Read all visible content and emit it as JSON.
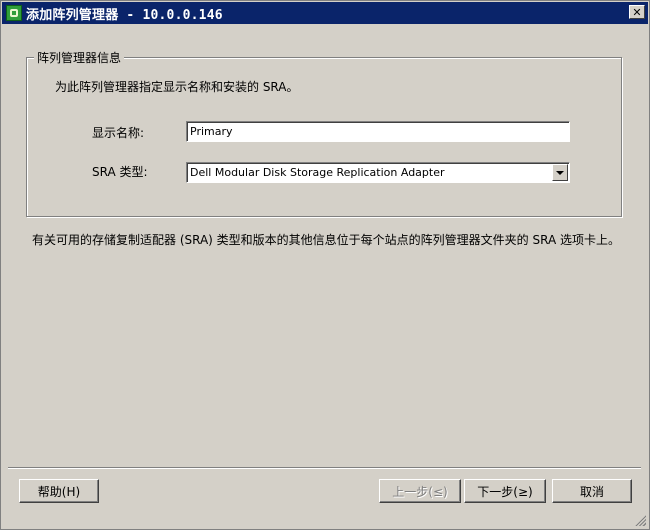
{
  "window": {
    "title": "添加阵列管理器 - 10.0.0.146",
    "app_icon": "srm-app-icon",
    "close_icon": "close-icon"
  },
  "group": {
    "legend": "阵列管理器信息",
    "description": "为此阵列管理器指定显示名称和安装的 SRA。"
  },
  "form": {
    "display_name_label": "显示名称:",
    "display_name_value": "Primary",
    "sra_type_label": "SRA 类型:",
    "sra_type_value": "Dell Modular Disk Storage Replication Adapter"
  },
  "info": {
    "text": "有关可用的存储复制适配器 (SRA) 类型和版本的其他信息位于每个站点的阵列管理器文件夹的 SRA 选项卡上。"
  },
  "buttons": {
    "help": "帮助(H)",
    "prev": "上一步(≤)",
    "next": "下一步(≥)",
    "cancel": "取消"
  },
  "colors": {
    "titlebar": "#0a246a",
    "dialog_bg": "#d4d0c8"
  }
}
